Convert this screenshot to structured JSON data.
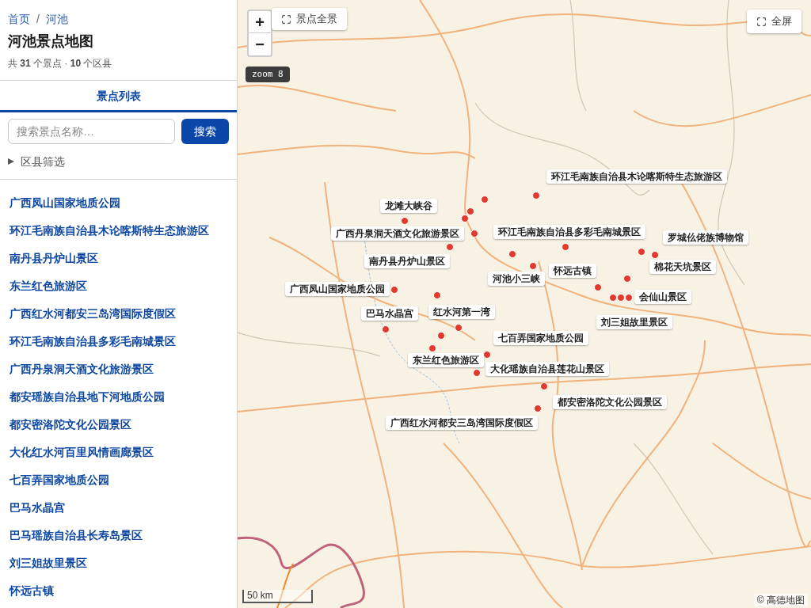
{
  "breadcrumb": {
    "items": [
      {
        "label": "首页"
      },
      {
        "label": "河池"
      }
    ],
    "separator": "/"
  },
  "title": "河池景点地图",
  "summary": "共 **31** 个景点 · **10** 个区县",
  "tabs": [
    {
      "label": "景点列表",
      "selected": true
    }
  ],
  "search": {
    "placeholder": "搜索景点名称…",
    "button": "搜索"
  },
  "district_filter": {
    "label": "区县筛选",
    "expanded": false
  },
  "spot_list": [
    {
      "name": "广西凤山国家地质公园"
    },
    {
      "name": "环江毛南族自治县木论喀斯特生态旅游区"
    },
    {
      "name": "南丹县丹炉山景区"
    },
    {
      "name": "东兰红色旅游区"
    },
    {
      "name": "广西红水河都安三岛湾国际度假区"
    },
    {
      "name": "环江毛南族自治县多彩毛南城景区"
    },
    {
      "name": "广西丹泉洞天酒文化旅游景区"
    },
    {
      "name": "都安瑶族自治县地下河地质公园"
    },
    {
      "name": "都安密洛陀文化公园景区"
    },
    {
      "name": "大化红水河百里风情画廊景区"
    },
    {
      "name": "七百弄国家地质公园"
    },
    {
      "name": "巴马水晶宫"
    },
    {
      "name": "巴马瑶族自治县长寿岛景区"
    },
    {
      "name": "刘三姐故里景区"
    },
    {
      "name": "怀远古镇"
    }
  ],
  "map": {
    "zoom_in": "+",
    "zoom_out": "−",
    "overview_button": "景点全景",
    "zoom_badge": "zoom 8",
    "fullscreen_button": "全屏",
    "labels": [
      {
        "name": "环江毛南族自治县木论喀斯特生态旅游区"
      },
      {
        "name": "龙滩大峡谷"
      },
      {
        "name": "广西丹泉洞天酒文化旅游景区"
      },
      {
        "name": "环江毛南族自治县多彩毛南城景区"
      },
      {
        "name": "罗城仫佬族博物馆"
      },
      {
        "name": "南丹县丹炉山景区"
      },
      {
        "name": "棉花天坑景区"
      },
      {
        "name": "怀远古镇"
      },
      {
        "name": "河池小三峡"
      },
      {
        "name": "广西凤山国家地质公园"
      },
      {
        "name": "会仙山景区"
      },
      {
        "name": "巴马水晶宫"
      },
      {
        "name": "红水河第一湾"
      },
      {
        "name": "刘三姐故里景区"
      },
      {
        "name": "七百弄国家地质公园"
      },
      {
        "name": "东兰红色旅游区"
      },
      {
        "name": "大化瑶族自治县莲花山景区"
      },
      {
        "name": "都安密洛陀文化公园景区"
      },
      {
        "name": "广西红水河都安三岛湾国际度假区"
      }
    ],
    "scale": "50 km",
    "attribution": "© 高德地图"
  }
}
